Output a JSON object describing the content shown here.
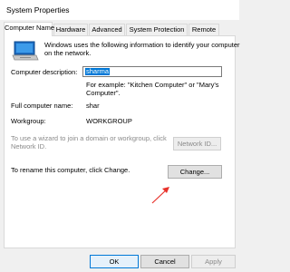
{
  "window": {
    "title": "System Properties"
  },
  "tabs": [
    {
      "label": "Computer Name",
      "active": true
    },
    {
      "label": "Hardware",
      "active": false
    },
    {
      "label": "Advanced",
      "active": false
    },
    {
      "label": "System Protection",
      "active": false
    },
    {
      "label": "Remote",
      "active": false
    }
  ],
  "intro": {
    "text_line1": "Windows uses the following information to identify your computer",
    "text_line2": "on the network."
  },
  "description": {
    "label": "Computer description:",
    "value": "sharma",
    "hint_line1": "For example: \"Kitchen Computer\" or \"Mary's",
    "hint_line2": "Computer\"."
  },
  "full_name": {
    "label": "Full computer name:",
    "value": "shar"
  },
  "workgroup": {
    "label": "Workgroup:",
    "value": "WORKGROUP"
  },
  "network_id": {
    "text_line1": "To use a wizard to join a domain or workgroup, click",
    "text_line2": "Network ID.",
    "button_label": "Network ID..."
  },
  "rename": {
    "text": "To rename this computer, click Change.",
    "button_label": "Change..."
  },
  "footer": {
    "ok_label": "OK",
    "cancel_label": "Cancel",
    "apply_label": "Apply"
  },
  "colors": {
    "accent": "#0078d7",
    "arrow": "#e8322b"
  }
}
